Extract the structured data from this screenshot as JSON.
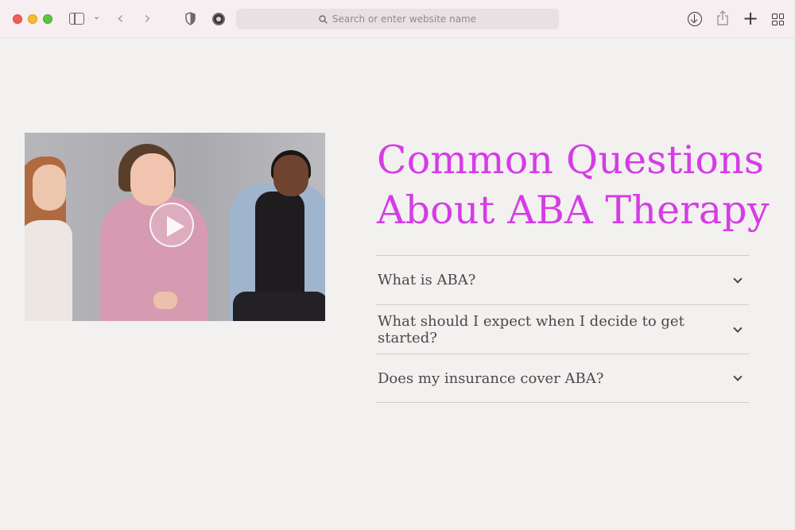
{
  "browser": {
    "address_placeholder": "Search or enter website name",
    "icons": [
      "sidebar-icon",
      "chevron-down-icon",
      "back-arrow-icon",
      "forward-arrow-icon",
      "shield-icon",
      "privacy-report-icon",
      "search-icon",
      "download-icon",
      "share-icon",
      "plus-icon",
      "tab-overview-icon"
    ]
  },
  "page": {
    "heading_line1": "Common Questions",
    "heading_line2": "About ABA Therapy",
    "accent_color": "#d53ce6",
    "faq": [
      {
        "question": "What is ABA?"
      },
      {
        "question": "What should I expect when I decide to get started?"
      },
      {
        "question": "Does my insurance cover ABA?"
      }
    ]
  }
}
